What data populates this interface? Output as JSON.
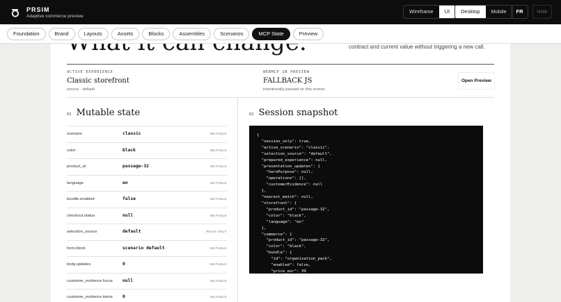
{
  "app": {
    "name": "PRSIM",
    "subtitle": "Adaptive commerce preview"
  },
  "view_toggle": {
    "options": [
      "Wireframe",
      "UI"
    ],
    "selected": "UI"
  },
  "device_toggle": {
    "options": [
      "Desktop",
      "Mobile"
    ],
    "selected": "Desktop"
  },
  "lang_label": "FR",
  "hide_label": "Hide",
  "nav": {
    "tabs": [
      "Foundation",
      "Brand",
      "Layouts",
      "Assets",
      "Blocks",
      "Assembles",
      "Scenarios",
      "MCP State",
      "Preview"
    ],
    "active": "MCP State"
  },
  "hero": {
    "title": "What it can change.",
    "note": "contract and current value without triggering a new call."
  },
  "active_experience": {
    "label": "ACTIVE EXPERIENCE",
    "value": "Classic storefront",
    "sub": "source · default"
  },
  "webmcp": {
    "label": "WEBMCP IN PREVIEW",
    "value": "FALLBACK JS",
    "sub": "intentionally paused on this screen"
  },
  "open_preview_label": "Open Preview",
  "mutable": {
    "number": "01",
    "title": "Mutable state",
    "rows": [
      {
        "key": "scenario",
        "value": "classic",
        "status": "MUTABLE"
      },
      {
        "key": "color",
        "value": "black",
        "status": "MUTABLE"
      },
      {
        "key": "product_id",
        "value": "passage-32",
        "status": "MUTABLE"
      },
      {
        "key": "language",
        "value": "en",
        "status": "MUTABLE"
      },
      {
        "key": "bundle.enabled",
        "value": "false",
        "status": "MUTABLE"
      },
      {
        "key": "checkout.status",
        "value": "null",
        "status": "MUTABLE"
      },
      {
        "key": "selection_source",
        "value": "default",
        "status": "READ ONLY"
      },
      {
        "key": "hero.block",
        "value": "scenario default",
        "status": "MUTABLE"
      },
      {
        "key": "body.updates",
        "value": "0",
        "status": "MUTABLE"
      },
      {
        "key": "customer_evidence.focus",
        "value": "null",
        "status": "MUTABLE"
      },
      {
        "key": "customer_evidence.items",
        "value": "0",
        "status": "MUTABLE"
      }
    ]
  },
  "session": {
    "number": "02",
    "title": "Session snapshot",
    "code_lines": [
      "{",
      "  \"session_only\": true,",
      "  \"active_scenario\": \"classic\",",
      "  \"selection_source\": \"default\",",
      "  \"prepared_experience\": null,",
      "  \"presentation_updates\": {",
      "    \"heroPurpose\": null,",
      "    \"operations\": [],",
      "    \"customerEvidence\": null",
      "  },",
      "  \"nearest_match\": null,",
      "  \"storefront\": {",
      "    \"product_id\": \"passage-32\",",
      "    \"color\": \"black\",",
      "    \"language\": \"en\"",
      "  },",
      "  \"commerce\": {",
      "    \"product_id\": \"passage-32\",",
      "    \"color\": \"black\",",
      "    \"bundle\": {",
      "      \"id\": \"organization_pack\",",
      "      \"enabled\": false,",
      "      \"price_eur\": 39"
    ]
  }
}
